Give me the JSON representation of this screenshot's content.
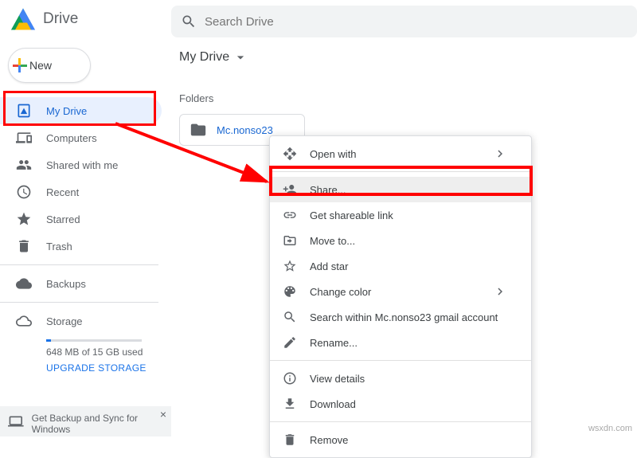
{
  "header": {
    "title": "Drive",
    "search_placeholder": "Search Drive"
  },
  "sidebar": {
    "new_label": "New",
    "items": [
      {
        "label": "My Drive"
      },
      {
        "label": "Computers"
      },
      {
        "label": "Shared with me"
      },
      {
        "label": "Recent"
      },
      {
        "label": "Starred"
      },
      {
        "label": "Trash"
      }
    ],
    "backups_label": "Backups",
    "storage_label": "Storage",
    "storage_used": "648 MB of 15 GB used",
    "upgrade_label": "UPGRADE STORAGE",
    "promo_text": "Get Backup and Sync for Windows"
  },
  "main": {
    "breadcrumb": "My Drive",
    "section_title": "Folders",
    "folder_name": "Mc.nonso23"
  },
  "context_menu": {
    "items": [
      {
        "label": "Open with",
        "submenu": true
      },
      {
        "label": "Share...",
        "divider_before": true,
        "highlight": true
      },
      {
        "label": "Get shareable link"
      },
      {
        "label": "Move to..."
      },
      {
        "label": "Add star"
      },
      {
        "label": "Change color",
        "submenu": true
      },
      {
        "label": "Search within Mc.nonso23 gmail account"
      },
      {
        "label": "Rename..."
      },
      {
        "label": "View details",
        "divider_before": true
      },
      {
        "label": "Download"
      },
      {
        "label": "Remove",
        "divider_before": true
      }
    ]
  },
  "watermark": "wsxdn.com"
}
